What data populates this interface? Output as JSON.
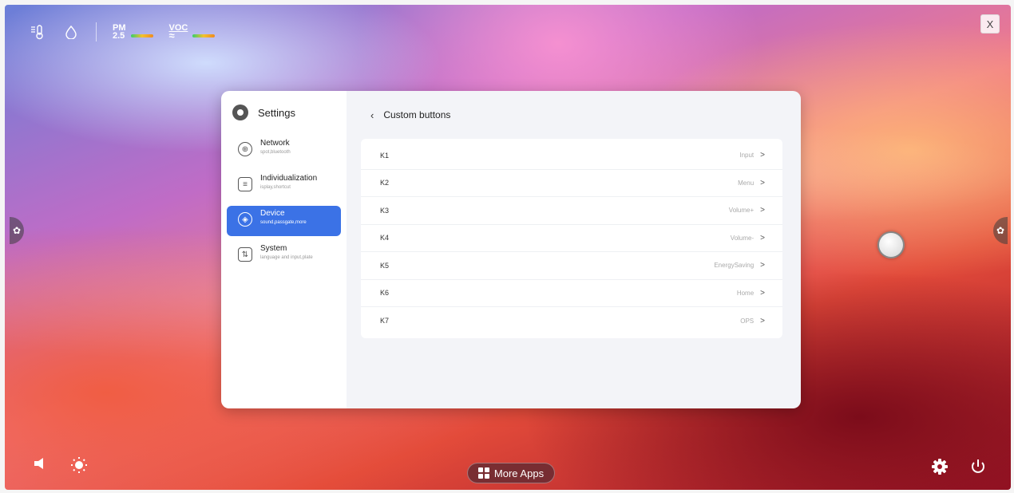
{
  "topbar": {
    "temp_icon": "thermometer-icon",
    "humidity_icon": "droplet-icon",
    "pm_label_top": "PM",
    "pm_label_bottom": "2.5",
    "voc_label": "VOC",
    "voc_wave": "≈"
  },
  "close_label": "X",
  "panel": {
    "title": "Settings",
    "nav": [
      {
        "label": "Network",
        "sub": "spot,bluetooth",
        "icon": "globe-icon"
      },
      {
        "label": "Individualization",
        "sub": "isplay,shortcut",
        "icon": "layout-icon"
      },
      {
        "label": "Device",
        "sub": "sound,passgate,more",
        "icon": "cube-icon"
      },
      {
        "label": "System",
        "sub": "language and input,plate",
        "icon": "sliders-icon"
      }
    ],
    "active_index": 2,
    "content_title": "Custom buttons",
    "rows": [
      {
        "key": "K1",
        "value": "Input"
      },
      {
        "key": "K2",
        "value": "Menu"
      },
      {
        "key": "K3",
        "value": "Volume+"
      },
      {
        "key": "K4",
        "value": "Volume-"
      },
      {
        "key": "K5",
        "value": "EnergySaving"
      },
      {
        "key": "K6",
        "value": "Home"
      },
      {
        "key": "K7",
        "value": "OPS"
      }
    ]
  },
  "dock": {
    "more_apps_label": "More Apps"
  },
  "colors": {
    "accent": "#3b72e6"
  }
}
